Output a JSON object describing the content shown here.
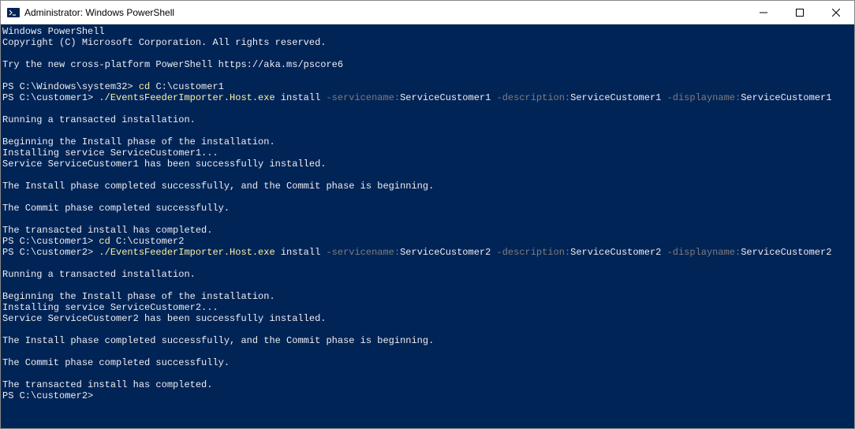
{
  "window": {
    "title": "Administrator: Windows PowerShell"
  },
  "terminal": {
    "header1": "Windows PowerShell",
    "header2": "Copyright (C) Microsoft Corporation. All rights reserved.",
    "header3": "Try the new cross-platform PowerShell https://aka.ms/pscore6",
    "prompt1": "PS C:\\Windows\\system32> ",
    "cmd1_cd": "cd ",
    "cmd1_path": "C:\\customer1",
    "prompt2": "PS C:\\customer1> ",
    "cmd2_exe": "./EventsFeederImporter.Host.exe ",
    "cmd2_install": "install ",
    "cmd2_flag1": "-servicename:",
    "cmd2_val1": "ServiceCustomer1 ",
    "cmd2_flag2": "-description:",
    "cmd2_val2": "ServiceCustomer1 ",
    "cmd2_flag3": "-displayname:",
    "cmd2_val3": "ServiceCustomer1",
    "out1_1": "Running a transacted installation.",
    "out1_2": "Beginning the Install phase of the installation.",
    "out1_3": "Installing service ServiceCustomer1...",
    "out1_4": "Service ServiceCustomer1 has been successfully installed.",
    "out1_5": "The Install phase completed successfully, and the Commit phase is beginning.",
    "out1_6": "The Commit phase completed successfully.",
    "out1_7": "The transacted install has completed.",
    "prompt3": "PS C:\\customer1> ",
    "cmd3_cd": "cd ",
    "cmd3_path": "C:\\customer2",
    "prompt4": "PS C:\\customer2> ",
    "cmd4_exe": "./EventsFeederImporter.Host.exe ",
    "cmd4_install": "install ",
    "cmd4_flag1": "-servicename:",
    "cmd4_val1": "ServiceCustomer2 ",
    "cmd4_flag2": "-description:",
    "cmd4_val2": "ServiceCustomer2 ",
    "cmd4_flag3": "-displayname:",
    "cmd4_val3": "ServiceCustomer2",
    "out2_1": "Running a transacted installation.",
    "out2_2": "Beginning the Install phase of the installation.",
    "out2_3": "Installing service ServiceCustomer2...",
    "out2_4": "Service ServiceCustomer2 has been successfully installed.",
    "out2_5": "The Install phase completed successfully, and the Commit phase is beginning.",
    "out2_6": "The Commit phase completed successfully.",
    "out2_7": "The transacted install has completed.",
    "prompt5": "PS C:\\customer2>"
  }
}
